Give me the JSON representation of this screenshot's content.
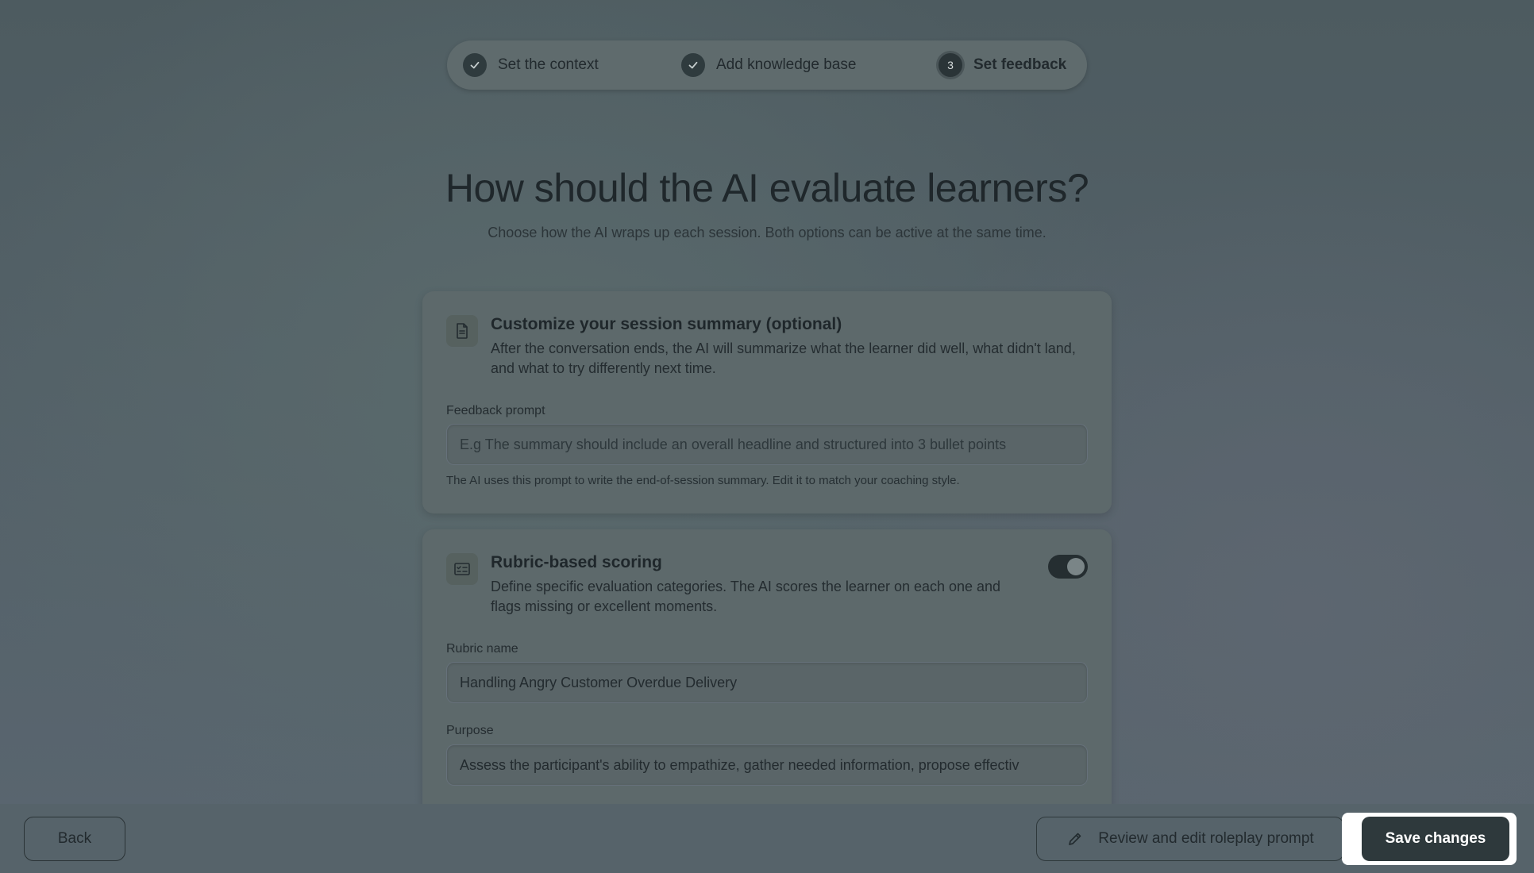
{
  "stepper": {
    "steps": [
      {
        "label": "Set the context",
        "state": "done"
      },
      {
        "label": "Add knowledge base",
        "state": "done"
      },
      {
        "label": "Set feedback",
        "state": "active",
        "number": "3"
      }
    ]
  },
  "heading": {
    "title": "How should the AI evaluate learners?",
    "subtitle": "Choose how the AI wraps up each session. Both options can be active at the same time."
  },
  "summary_card": {
    "icon": "document-icon",
    "title": "Customize your session summary (optional)",
    "description": "After the conversation ends, the AI will summarize what the learner did well, what didn't land, and what to try differently next time.",
    "field_label": "Feedback prompt",
    "placeholder": "E.g The summary should include an overall headline and structured into 3 bullet points",
    "hint": "The AI uses this prompt to write the end-of-session summary. Edit it to match your coaching style."
  },
  "rubric_card": {
    "icon": "checklist-icon",
    "title": "Rubric-based scoring",
    "description": "Define specific evaluation categories. The AI scores the learner on each one and flags missing or excellent moments.",
    "toggle_on": true,
    "rubric_name_label": "Rubric name",
    "rubric_name_value": "Handling Angry Customer Overdue Delivery",
    "purpose_label": "Purpose",
    "purpose_value": "Assess the participant's ability to empathize, gather needed information, propose effectiv"
  },
  "footer": {
    "back_label": "Back",
    "review_label": "Review and edit roleplay prompt",
    "save_label": "Save changes"
  }
}
